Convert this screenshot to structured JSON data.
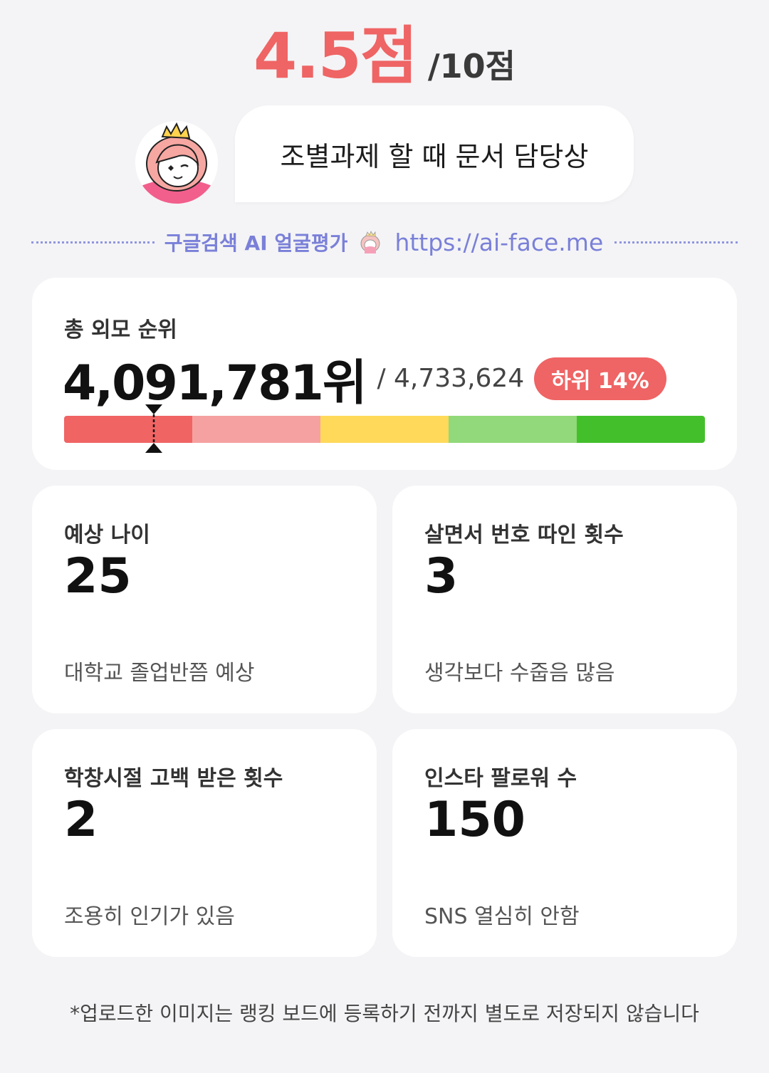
{
  "header": {
    "score": "4.5점",
    "score_total": "/10점"
  },
  "comment": {
    "text": "조별과제 할 때 문서 담당상",
    "avatar_icon": "princess-face-icon"
  },
  "watermark": {
    "label": "구글검색 AI 얼굴평가",
    "url": "https://ai-face.me",
    "color": "#7a80d8"
  },
  "rank": {
    "label": "총 외모 순위",
    "value": "4,091,781위",
    "total": "/ 4,733,624",
    "badge": "하위 14%",
    "percentile_position": 0.14,
    "segment_colors": [
      "#f06464",
      "#f5a1a1",
      "#ffd95a",
      "#91d97a",
      "#44bf2c"
    ]
  },
  "stats": [
    {
      "label": "예상 나이",
      "value": "25",
      "desc": "대학교 졸업반쯤 예상"
    },
    {
      "label": "살면서 번호 따인 횟수",
      "value": "3",
      "desc": "생각보다 수줍음 많음"
    },
    {
      "label": "학창시절 고백 받은 횟수",
      "value": "2",
      "desc": "조용히 인기가 있음"
    },
    {
      "label": "인스타 팔로워 수",
      "value": "150",
      "desc": "SNS 열심히 안함"
    }
  ],
  "footnote": "*업로드한 이미지는 랭킹 보드에 등록하기 전까지 별도로 저장되지 않습니다",
  "colors": {
    "accent": "#ef6464",
    "background": "#f4f4f6"
  }
}
